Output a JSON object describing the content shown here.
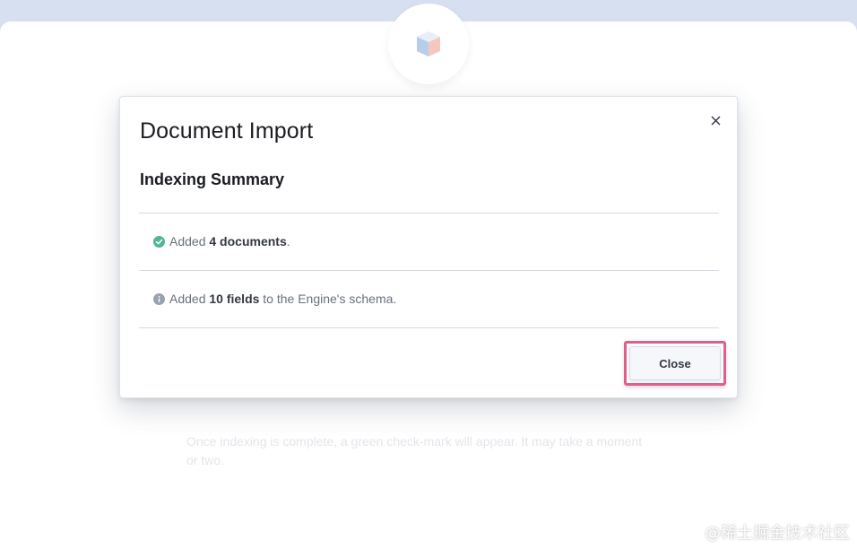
{
  "background": {
    "hint_text": "Once indexing is complete, a green check-mark will appear. It may take a moment or two."
  },
  "logo": {
    "icon": "app-search-logo-icon"
  },
  "modal": {
    "title": "Document Import",
    "close_icon": "close-icon",
    "subtitle": "Indexing Summary",
    "rows": [
      {
        "icon": "check-circle-icon",
        "icon_color": "#54b399",
        "prefix": "Added ",
        "bold": "4 documents",
        "suffix": "."
      },
      {
        "icon": "info-circle-icon",
        "icon_color": "#98a2b3",
        "prefix": "Added ",
        "bold": "10 fields",
        "suffix": " to the Engine's schema."
      }
    ],
    "close_button_label": "Close",
    "highlight_color": "#e0608a"
  },
  "watermark": "@稀土掘金技术社区"
}
